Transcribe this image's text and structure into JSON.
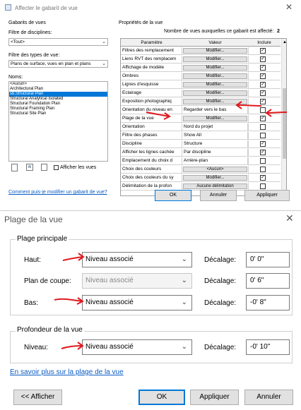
{
  "top_dialog": {
    "title": "Affecter le gabarit de vue",
    "left_panel": {
      "group_title": "Gabarits de vues",
      "discipline_label": "Filtre de disciplines:",
      "discipline_value": "<Tout>",
      "view_type_label": "Filtre des types de vue:",
      "view_type_value": "Plans de surface, vues en plan et plans",
      "names_label": "Noms:",
      "names": [
        "<Aucun>",
        "Architectural Plan",
        "sb.Structural Plan",
        "Structural Analytical Isolated",
        "Structural Foundation Plan",
        "Structural Framing Plan",
        "Structural Site Plan"
      ],
      "selected_name_index": 2,
      "show_views_label": "Afficher les vues",
      "show_views_checked": false,
      "help_link": "Comment puis-je modifier un gabarit de vue?"
    },
    "properties": {
      "group_title": "Propriétés de la vue",
      "count_label": "Nombre de vues auxquelles ce gabarit est affecté:",
      "count_value": "2",
      "headers": [
        "Paramètre",
        "Valeur",
        "Inclure"
      ],
      "rows": [
        {
          "param": "Filtres des remplacement",
          "value": "Modifier...",
          "button": true,
          "include": true
        },
        {
          "param": "Liens RVT des remplacem",
          "value": "Modifier...",
          "button": true,
          "include": true
        },
        {
          "param": "Affichage de modèle",
          "value": "Modifier...",
          "button": true,
          "include": true
        },
        {
          "param": "Ombres",
          "value": "Modifier...",
          "button": true,
          "include": true
        },
        {
          "param": "Lignes d'esquisse",
          "value": "Modifier...",
          "button": true,
          "include": true
        },
        {
          "param": "Eclairage",
          "value": "Modifier...",
          "button": true,
          "include": true
        },
        {
          "param": "Exposition photographiq",
          "value": "Modifier...",
          "button": true,
          "include": true
        },
        {
          "param": "Orientation du niveau en",
          "value": "Regarder vers le bas",
          "button": false,
          "include": false
        },
        {
          "param": "Plage de la vue",
          "value": "Modifier...",
          "button": true,
          "include": true
        },
        {
          "param": "Orientation",
          "value": "Nord du projet",
          "button": false,
          "include": false
        },
        {
          "param": "Filtre des phases",
          "value": "Show All",
          "button": false,
          "include": false
        },
        {
          "param": "Discipline",
          "value": "Structure",
          "button": false,
          "include": true
        },
        {
          "param": "Afficher les lignes cachée",
          "value": "Par discipline",
          "button": false,
          "include": true
        },
        {
          "param": "Emplacement du choix d",
          "value": "Arrière-plan",
          "button": false,
          "include": false
        },
        {
          "param": "Choix des couleurs",
          "value": "<Aucun>",
          "button": true,
          "include": false
        },
        {
          "param": "Choix des couleurs du sy",
          "value": "Modifier...",
          "button": true,
          "include": true
        },
        {
          "param": "Délimitation de la profon",
          "value": "Aucune délimitation",
          "button": true,
          "include": false
        }
      ]
    },
    "buttons": {
      "ok": "OK",
      "cancel": "Annuler",
      "apply": "Appliquer"
    }
  },
  "bottom_dialog": {
    "title": "Plage de la vue",
    "primary_group": "Plage principale",
    "rows": [
      {
        "label": "Haut:",
        "value": "Niveau associé",
        "enabled": true,
        "offset_label": "Décalage:",
        "offset": "0'  0\""
      },
      {
        "label": "Plan de coupe:",
        "value": "Niveau associé",
        "enabled": false,
        "offset_label": "Décalage:",
        "offset": "0'  6\""
      },
      {
        "label": "Bas:",
        "value": "Niveau associé",
        "enabled": true,
        "offset_label": "Décalage:",
        "offset": "-0'  8\""
      }
    ],
    "depth_group": "Profondeur de la vue",
    "depth_row": {
      "label": "Niveau:",
      "value": "Niveau associé",
      "offset_label": "Décalage:",
      "offset": "-0'  10\""
    },
    "help_link": "En savoir plus sur la plage de la vue",
    "buttons": {
      "show": "<< Afficher",
      "ok": "OK",
      "apply": "Appliquer",
      "cancel": "Annuler"
    }
  },
  "colors": {
    "accent": "#0078d7",
    "annotation_red": "#e0191e",
    "link": "#0a5bc4"
  }
}
